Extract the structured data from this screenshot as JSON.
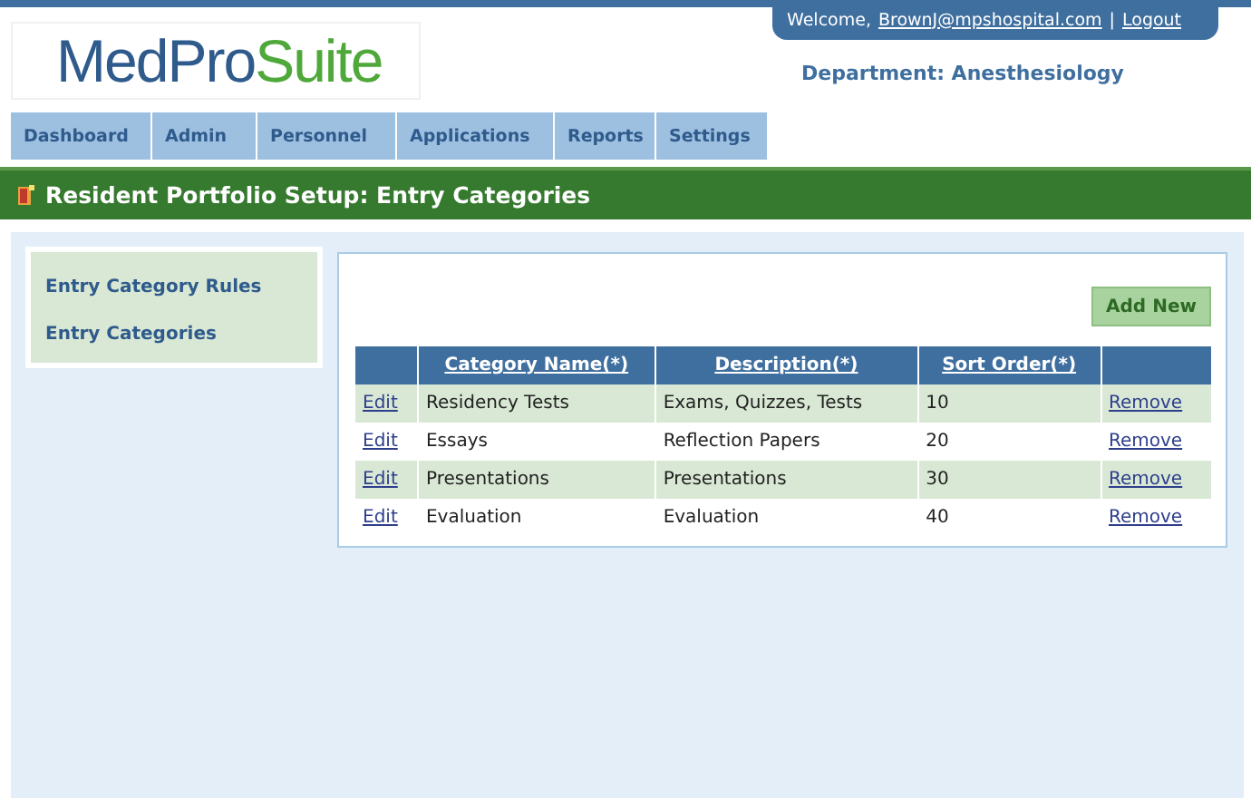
{
  "logo": {
    "part_1": "MedPro",
    "part_2": "Suite"
  },
  "user_bar": {
    "welcome": "Welcome,",
    "email": "BrownJ@mpshospital.com",
    "separator": "|",
    "logout": "Logout"
  },
  "department": "Department: Anesthesiology",
  "nav_tabs": [
    {
      "label": "Dashboard"
    },
    {
      "label": "Admin"
    },
    {
      "label": "Personnel"
    },
    {
      "label": "Applications"
    },
    {
      "label": "Reports"
    },
    {
      "label": "Settings"
    }
  ],
  "page_title": "Resident Portfolio Setup: Entry Categories",
  "sidebar": {
    "items": [
      {
        "label": "Entry Category Rules"
      },
      {
        "label": "Entry Categories"
      }
    ]
  },
  "add_button": "Add New",
  "table": {
    "columns": [
      "",
      "Category Name(*)",
      "Description(*)",
      "Sort Order(*)",
      ""
    ],
    "rows": [
      {
        "edit": "Edit",
        "name": "Residency Tests",
        "description": "Exams, Quizzes, Tests",
        "sort_order": "10",
        "remove": "Remove"
      },
      {
        "edit": "Edit",
        "name": "Essays",
        "description": "Reflection Papers",
        "sort_order": "20",
        "remove": "Remove"
      },
      {
        "edit": "Edit",
        "name": "Presentations",
        "description": "Presentations",
        "sort_order": "30",
        "remove": "Remove"
      },
      {
        "edit": "Edit",
        "name": "Evaluation",
        "description": "Evaluation",
        "sort_order": "40",
        "remove": "Remove"
      }
    ]
  }
}
